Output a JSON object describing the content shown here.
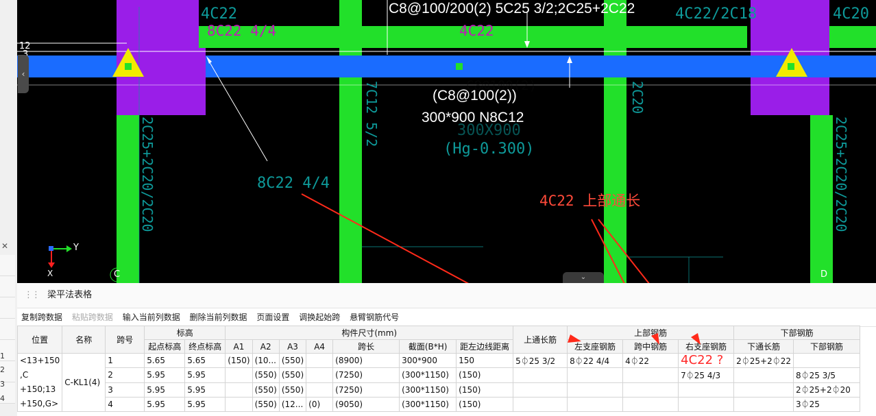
{
  "cad": {
    "top_annotation": "C8@100/200(2) 5C25 3/2;2C25+2C22",
    "top_label_left": "4C22",
    "top_label_right1": "4C22/2C18",
    "top_label_right2": "4C20",
    "magenta_left": "8C22 4/4",
    "magenta_mid": "4C22",
    "center_stirrup": "(C8@100(2))",
    "center_section": "300*900 N8C12",
    "cyan_left_note": "8C22 4/4",
    "red_note": "4C22 上部通长",
    "vertical_left": "2C25+2C20/2C20",
    "vertical_right": "2C25+2C20/2C20",
    "vertical_mid": "7C12 5/2",
    "vertical_mid2": "2C20",
    "ghost_text1": "C8@100(2)",
    "ghost_text2": "N8C12",
    "ghost_text3": "300X900",
    "ghost_text4": "(Hg-0.300)",
    "axis_c": "C",
    "axis_d": "D",
    "axis_y": "Y",
    "axis_x": "X",
    "left_num1": "12",
    "left_num2": "3"
  },
  "panel": {
    "title": "梁平法表格",
    "toolbar": [
      "复制跨数据",
      "粘贴跨数据",
      "输入当前列数据",
      "删除当前列数据",
      "页面设置",
      "调换起始跨",
      "悬臂钢筋代号"
    ]
  },
  "table": {
    "headers_top": {
      "position": "位置",
      "name": "名称",
      "span": "跨号",
      "elevation": "标高",
      "dimensions": "构件尺寸(mm)",
      "upper_rebar": "上部钢筋",
      "lower_rebar": "下部钢筋"
    },
    "headers_sub": [
      "起点标高",
      "终点标高",
      "A1",
      "A2",
      "A3",
      "A4",
      "跨长",
      "截面(B*H)",
      "距左边线距离",
      "上通长筋",
      "左支座钢筋",
      "跨中钢筋",
      "右支座钢筋",
      "下通长筋",
      "下部钢筋"
    ],
    "position_value": "<13+150,C+150;13+150,G>",
    "position_lines": [
      "<13+150",
      ",C",
      "+150;13",
      "+150,G>"
    ],
    "name_value": "C-KL1(4)",
    "rows": [
      {
        "num": "1",
        "span": "1",
        "start": "5.65",
        "end": "5.65",
        "a1": "(150)",
        "a2": "(10...",
        "a3": "(550)",
        "a4": "",
        "len": "(8900)",
        "sec": "300*900",
        "dist": "150",
        "top_through": "5⏀25 3/2",
        "left_sup": "8⏀22 4/4",
        "mid": "4⏀22",
        "right_sup": "4C22 ?",
        "bot_through": "2⏀25+2⏀22",
        "bottom": ""
      },
      {
        "num": "2",
        "span": "2",
        "start": "5.95",
        "end": "5.95",
        "a1": "",
        "a2": "(550)",
        "a3": "(550)",
        "a4": "",
        "len": "(7250)",
        "sec": "(300*1150)",
        "dist": "(150)",
        "top_through": "",
        "left_sup": "",
        "mid": "",
        "right_sup": "7⏀25 4/3",
        "bot_through": "",
        "bottom": "8⏀25 3/5"
      },
      {
        "num": "3",
        "span": "3",
        "start": "5.95",
        "end": "5.95",
        "a1": "",
        "a2": "(550)",
        "a3": "(550)",
        "a4": "",
        "len": "(7250)",
        "sec": "(300*1150)",
        "dist": "(150)",
        "top_through": "",
        "left_sup": "",
        "mid": "",
        "right_sup": "",
        "bot_through": "",
        "bottom": "2⏀25+2⏀20"
      },
      {
        "num": "4",
        "span": "4",
        "start": "5.95",
        "end": "5.95",
        "a1": "",
        "a2": "(550)",
        "a3": "(12...",
        "a4": "(0)",
        "len": "(9050)",
        "sec": "(300*1150)",
        "dist": "(150)",
        "top_through": "",
        "left_sup": "",
        "mid": "",
        "right_sup": "",
        "bot_through": "",
        "bottom": "3⏀25"
      }
    ]
  },
  "colors": {
    "beam_blue": "#1a6cff",
    "column_purple": "#9a1ee8",
    "green": "#22e02a",
    "cyan_text": "#0e9a9a",
    "magenta_text": "#c01ab8",
    "red_arrow": "#ff2a1a"
  }
}
